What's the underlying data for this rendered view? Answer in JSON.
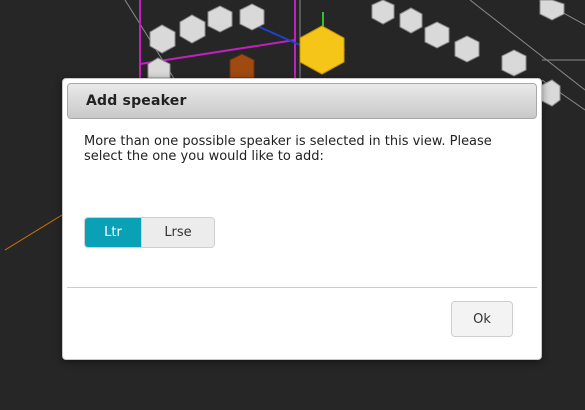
{
  "dialog": {
    "title": "Add speaker",
    "message": "More than one possible speaker is selected in this view. Please select the one you would like to add:",
    "speaker_options": [
      {
        "label": "Ltr",
        "selected": true
      },
      {
        "label": "Lrse",
        "selected": false
      }
    ],
    "ok_label": "Ok"
  },
  "colors": {
    "viewport_background": "#262626",
    "selected_option": "#0aa1b6",
    "selected_speaker": "#f5c518",
    "highlighted_speaker": "#a04a12",
    "speaker_cube": "#d9d9d9",
    "grid_magenta": "#c020c0"
  }
}
